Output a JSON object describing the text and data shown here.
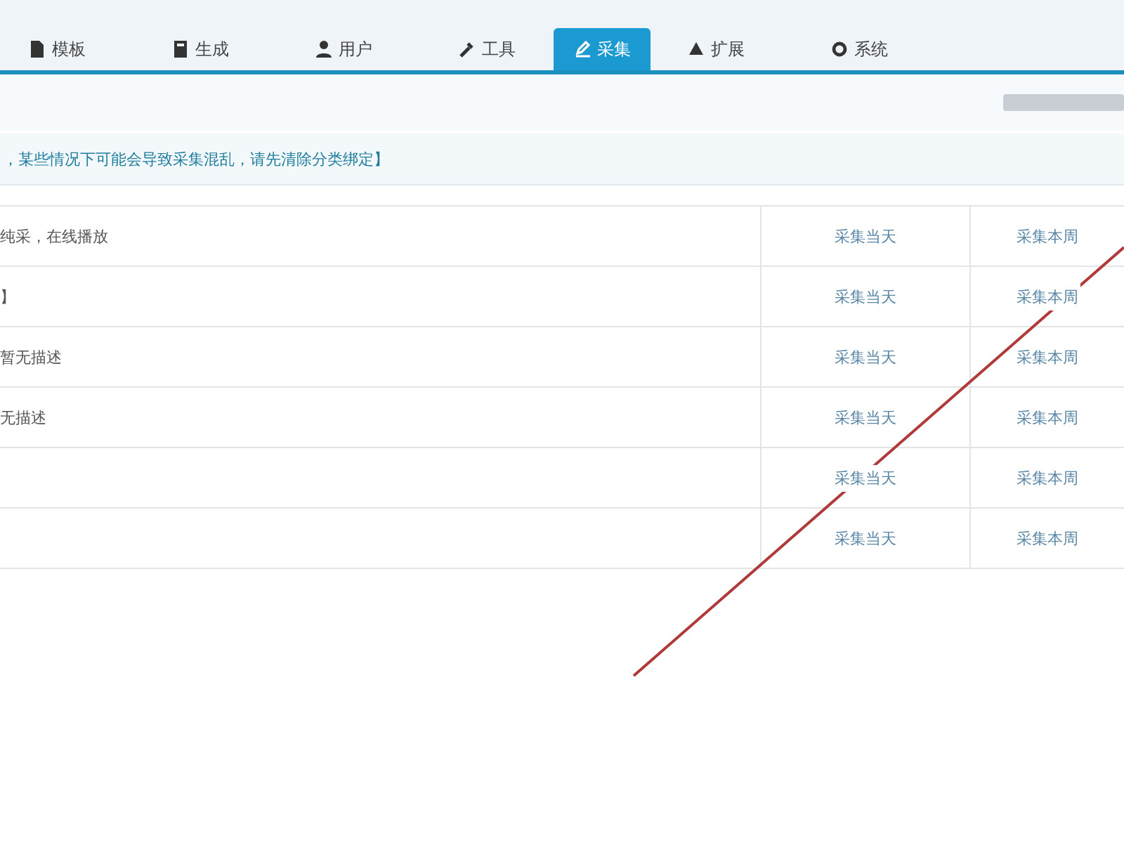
{
  "tabs": [
    {
      "label": "模板",
      "selected": false
    },
    {
      "label": "生成",
      "selected": false
    },
    {
      "label": "用户",
      "selected": false
    },
    {
      "label": "工具",
      "selected": false
    },
    {
      "label": "采集",
      "selected": true
    },
    {
      "label": "扩展",
      "selected": false
    },
    {
      "label": "系统",
      "selected": false
    }
  ],
  "notice": "，某些情况下可能会导致采集混乱，请先清除分类绑定】",
  "rows": [
    {
      "description": "纯采，在线播放",
      "action_1": "采集当天",
      "action_2": "采集本周"
    },
    {
      "description": "】",
      "action_1": "采集当天",
      "action_2": "采集本周"
    },
    {
      "description": "暂无描述",
      "action_1": "采集当天",
      "action_2": "采集本周"
    },
    {
      "description": "无描述",
      "action_1": "采集当天",
      "action_2": "采集本周"
    },
    {
      "description": "",
      "action_1": "采集当天",
      "action_2": "采集本周"
    },
    {
      "description": "",
      "action_1": "采集当天",
      "action_2": "采集本周"
    }
  ]
}
